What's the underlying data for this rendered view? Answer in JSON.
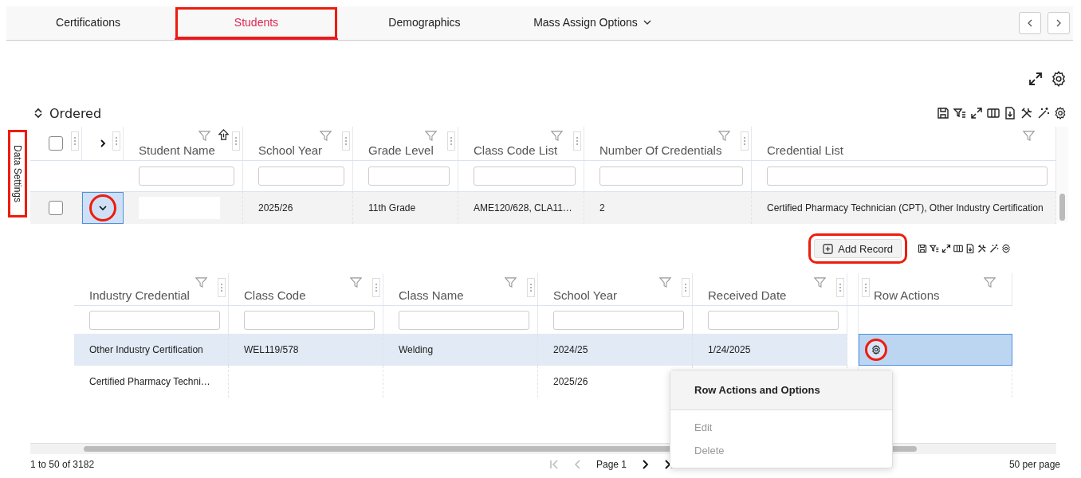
{
  "tabs": [
    {
      "label": "Certifications",
      "kind": "tab",
      "selected": false,
      "highlighted": false
    },
    {
      "label": "Students",
      "kind": "tab",
      "selected": true,
      "highlighted": true
    },
    {
      "label": "Demographics",
      "kind": "tab",
      "selected": false,
      "highlighted": false
    },
    {
      "label": "Mass Assign Options",
      "kind": "dropdown",
      "selected": false,
      "highlighted": false
    }
  ],
  "side_panel": {
    "label": "Data Settings",
    "highlighted": true
  },
  "grid": {
    "title": "Ordered",
    "all_checked": false,
    "columns": [
      "Student Name",
      "School Year",
      "Grade Level",
      "Class Code List",
      "Number Of Credentials",
      "Credential List"
    ],
    "rows": [
      {
        "checked": false,
        "expanded": true,
        "highlighted": true,
        "name_hidden": true,
        "cells": [
          "",
          "2025/26",
          "11th Grade",
          "AME120/628, CLA11…",
          "2",
          "Certified Pharmacy Technician (CPT), Other Industry Certification"
        ]
      }
    ]
  },
  "detail": {
    "add_button": "Add Record",
    "add_highlighted": true,
    "actions_button_highlighted": true,
    "columns": [
      "Industry Credential",
      "Class Code",
      "Class Name",
      "School Year",
      "Received Date",
      "Row Actions"
    ],
    "rows": [
      {
        "selected": true,
        "cells": [
          "Other Industry Certification",
          "WEL119/578",
          "Welding",
          "2024/25",
          "1/24/2025",
          ""
        ]
      },
      {
        "selected": false,
        "cells": [
          "Certified Pharmacy Techni…",
          "",
          "",
          "2025/26",
          "",
          ""
        ]
      }
    ]
  },
  "menu": {
    "title": "Row Actions and Options",
    "items": [
      {
        "label": "Edit",
        "disabled": true
      },
      {
        "label": "Delete",
        "disabled": true
      }
    ]
  },
  "footer": {
    "range": "1 to 50 of 3182",
    "page": "Page 1",
    "per_page": "50 per page"
  }
}
